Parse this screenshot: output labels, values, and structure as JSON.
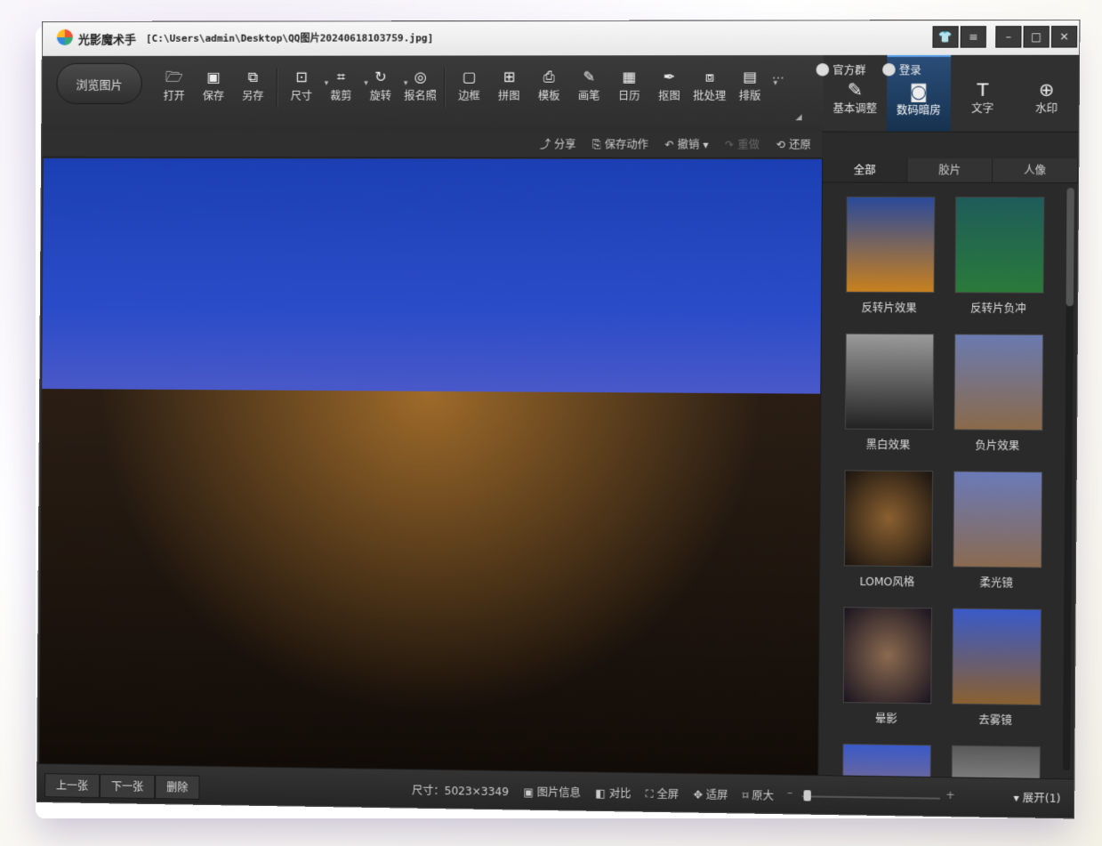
{
  "window": {
    "app_name": "光影魔术手",
    "file_path": "[C:\\Users\\admin\\Desktop\\QQ图片20240618103759.jpg]"
  },
  "top_links": {
    "group": "官方群",
    "login": "登录"
  },
  "toolbar": {
    "browse": "浏览图片",
    "tools": [
      {
        "label": "打开",
        "icon": "open-icon"
      },
      {
        "label": "保存",
        "icon": "save-icon"
      },
      {
        "label": "另存",
        "icon": "save-as-icon"
      },
      {
        "label": "尺寸",
        "icon": "resize-icon"
      },
      {
        "label": "裁剪",
        "icon": "crop-icon"
      },
      {
        "label": "旋转",
        "icon": "rotate-icon"
      },
      {
        "label": "报名照",
        "icon": "id-photo-icon"
      },
      {
        "label": "边框",
        "icon": "border-icon"
      },
      {
        "label": "拼图",
        "icon": "collage-icon"
      },
      {
        "label": "模板",
        "icon": "template-icon"
      },
      {
        "label": "画笔",
        "icon": "brush-icon"
      },
      {
        "label": "日历",
        "icon": "calendar-icon"
      },
      {
        "label": "抠图",
        "icon": "cutout-icon"
      },
      {
        "label": "批处理",
        "icon": "batch-icon"
      },
      {
        "label": "排版",
        "icon": "layout-icon"
      }
    ],
    "more": "···"
  },
  "panel_tabs": [
    {
      "label": "基本调整",
      "icon": "edit-icon"
    },
    {
      "label": "数码暗房",
      "icon": "camera-icon"
    },
    {
      "label": "文字",
      "icon": "text-icon"
    },
    {
      "label": "水印",
      "icon": "watermark-icon"
    }
  ],
  "actions": {
    "share": "分享",
    "save_action": "保存动作",
    "undo": "撤销",
    "redo": "重做",
    "restore": "还原"
  },
  "filter_tabs": [
    "全部",
    "胶片",
    "人像"
  ],
  "filters": [
    {
      "name": "反转片效果",
      "color": "#c8801e"
    },
    {
      "name": "反转片负冲",
      "color": "#1e5c5a"
    },
    {
      "name": "黑白效果",
      "color": "#888888"
    },
    {
      "name": "负片效果",
      "color": "#8a6a4a"
    },
    {
      "name": "LOMO风格",
      "color": "#3a2c1c"
    },
    {
      "name": "柔光镜",
      "color": "#8a6a50"
    },
    {
      "name": "晕影",
      "color": "#3a3040"
    },
    {
      "name": "去雾镜",
      "color": "#8a6030"
    },
    {
      "name": "",
      "color": "#5a6aa0"
    },
    {
      "name": "",
      "color": "#6a6a6a"
    }
  ],
  "status": {
    "prev": "上一张",
    "next": "下一张",
    "delete": "删除",
    "size_label": "尺寸：5023×3349",
    "info": "图片信息",
    "compare": "对比",
    "fullscreen": "全屏",
    "fit": "适屏",
    "original": "原大",
    "expand": "展开(1)"
  }
}
